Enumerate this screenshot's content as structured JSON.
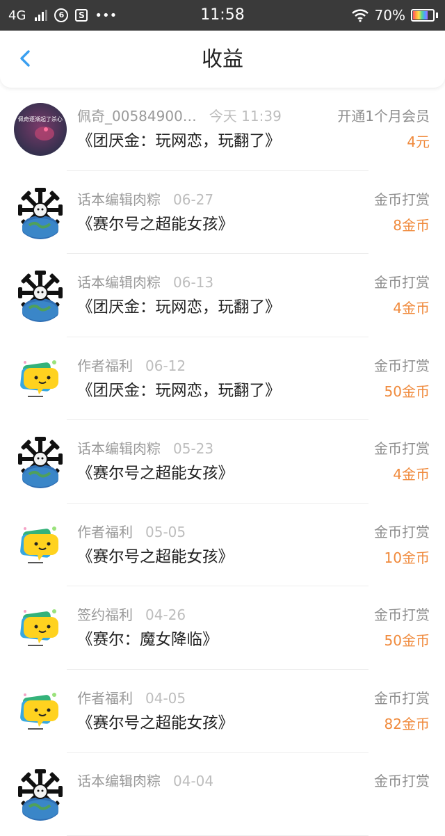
{
  "status_bar": {
    "network": "4G",
    "time": "11:58",
    "battery": "70%",
    "app_icon_s": "S",
    "more": "•••"
  },
  "header": {
    "title": "收益"
  },
  "rows": [
    {
      "name": "佩奇_00584900…",
      "date": "今天 11:39",
      "book": "《团厌金：玩网恋，玩翻了》",
      "type": "开通1个月会员",
      "amount": "4元",
      "avatar": "photo",
      "avatar_caption": "佩奇逐渐起了杀心"
    },
    {
      "name": "话本编辑肉粽",
      "date": "06-27",
      "book": "《赛尔号之超能女孩》",
      "type": "金币打赏",
      "amount": "8金币",
      "avatar": "globe"
    },
    {
      "name": "话本编辑肉粽",
      "date": "06-13",
      "book": "《团厌金：玩网恋，玩翻了》",
      "type": "金币打赏",
      "amount": "4金币",
      "avatar": "globe"
    },
    {
      "name": "作者福利",
      "date": "06-12",
      "book": "《团厌金：玩网恋，玩翻了》",
      "type": "金币打赏",
      "amount": "50金币",
      "avatar": "chat"
    },
    {
      "name": "话本编辑肉粽",
      "date": "05-23",
      "book": "《赛尔号之超能女孩》",
      "type": "金币打赏",
      "amount": "4金币",
      "avatar": "globe"
    },
    {
      "name": "作者福利",
      "date": "05-05",
      "book": "《赛尔号之超能女孩》",
      "type": "金币打赏",
      "amount": "10金币",
      "avatar": "chat"
    },
    {
      "name": "签约福利",
      "date": "04-26",
      "book": "《赛尔：魔女降临》",
      "type": "金币打赏",
      "amount": "50金币",
      "avatar": "chat"
    },
    {
      "name": "作者福利",
      "date": "04-05",
      "book": "《赛尔号之超能女孩》",
      "type": "金币打赏",
      "amount": "82金币",
      "avatar": "chat"
    },
    {
      "name": "话本编辑肉粽",
      "date": "04-04",
      "book": "",
      "type": "金币打赏",
      "amount": "",
      "avatar": "globe"
    }
  ]
}
